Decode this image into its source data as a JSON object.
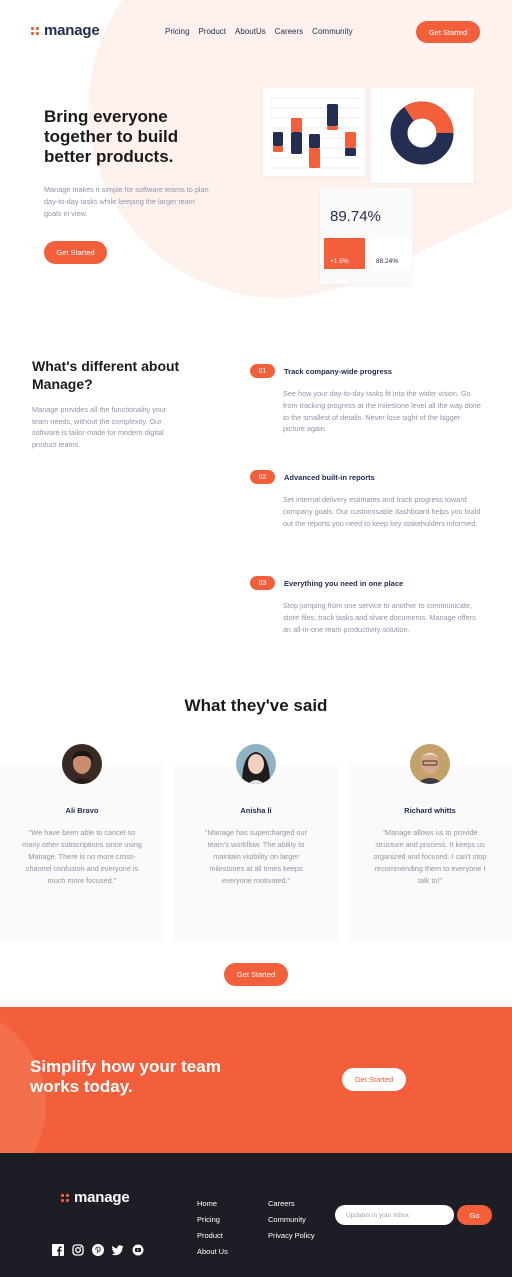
{
  "header": {
    "logo_text": "manage",
    "nav": [
      "Pricing",
      "Product",
      "AboutUs",
      "Careers",
      "Community"
    ],
    "cta_label": "Get Started"
  },
  "hero": {
    "title": "Bring everyone together to build better products.",
    "text": "Manage makes it simple for software teams to plan day-to-day tasks while keeping the larger team goals in view.",
    "cta_label": "Get Started",
    "stat_main": "89.74%",
    "stat_orange": "+1.5%",
    "stat_white": "88.24%"
  },
  "different": {
    "title": "What's different about Manage?",
    "text": "Manage provides all the functionality your team needs, without the complexity. Our software is tailor-made for modern digital product teams.",
    "features": [
      {
        "num": "01",
        "title": "Track company-wide progress",
        "text": "See how your day-to-day tasks fit into the wider vision. Go from tracking progress at the milestone level all the way done to the smallest of details. Never lose sight of the bigger picture again."
      },
      {
        "num": "02",
        "title": "Advanced built-in reports",
        "text": "Set internal delivery estimates and track progress toward company goals. Our customisable dashboard helps you build out the reports you need to keep key stakeholders informed."
      },
      {
        "num": "03",
        "title": "Everything you need in one place",
        "text": "Stop jumping from one service to another to communicate, store files, track tasks and share documents. Manage offers an all-in-one team productivity solution."
      }
    ]
  },
  "testimonials": {
    "title": "What they've said",
    "items": [
      {
        "name": "Ali Bravo",
        "quote": "\"We have been able to cancel so many other subscriptions since using Manage. There is no more cross-channel confusion and everyone is much more focused.\""
      },
      {
        "name": "Anisha li",
        "quote": "\"Manage has supercharged our team's workflow. The ability to maintain visibility on larger milestones at all times keeps everyone motivated.\""
      },
      {
        "name": "Richard whitts",
        "quote": "\"Manage allows us to provide structure and process. It keeps us organized and focused. I can't stop recommending them to everyone I talk to!\""
      }
    ],
    "cta_label": "Get Started"
  },
  "cta": {
    "title": "Simplify how your team works today.",
    "button_label": "Get Started"
  },
  "footer": {
    "logo_text": "manage",
    "col1": [
      "Home",
      "Pricing",
      "Product",
      "About Us"
    ],
    "col2": [
      "Careers",
      "Community",
      "Privacy Policy"
    ],
    "input_placeholder": "Updates in your inbox",
    "go_label": "Go",
    "social": [
      "facebook-icon",
      "instagram-icon",
      "pinterest-icon",
      "twitter-icon",
      "youtube-icon"
    ]
  },
  "colors": {
    "accent": "#f25f3a",
    "navy": "#242d52",
    "footer_bg": "#1d1e25",
    "muted_text": "#9095a7"
  }
}
